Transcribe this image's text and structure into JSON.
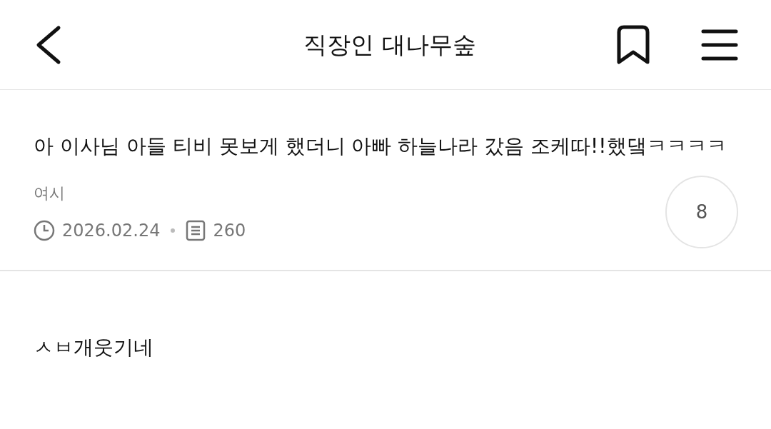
{
  "header": {
    "title": "직장인 대나무숲"
  },
  "post": {
    "title": "아 이사님 아들 티비 못보게 했더니 아빠 하늘나라 갔음 조케따!!했댘ㅋㅋㅋㅋ",
    "author": "여시",
    "date": "2026.02.24",
    "views": "260",
    "comment_count": "8"
  },
  "body": "ㅅㅂ개웃기네"
}
